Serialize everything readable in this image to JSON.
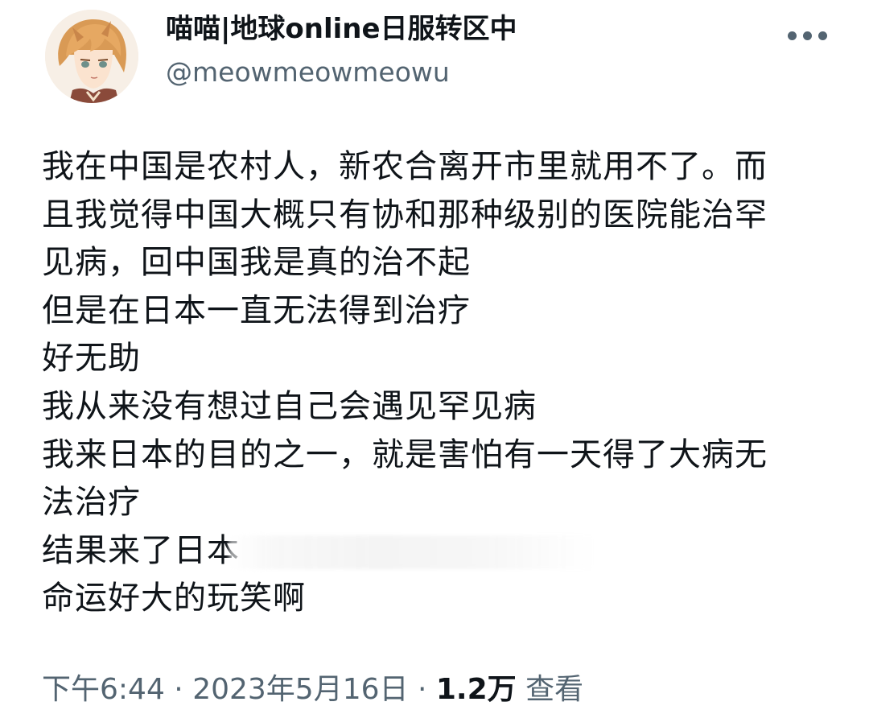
{
  "user": {
    "display_name": "喵喵|地球online日服转区中",
    "handle": "@meowmeowmeowu",
    "avatar_icon": "anime-avatar"
  },
  "more_icon": "more-horizontal-icon",
  "tweet": {
    "lines": [
      "我在中国是农村人，新农合离开市里就用不了。而",
      "且我觉得中国大概只有协和那种级别的医院能治罕",
      "见病，回中国我是真的治不起",
      "但是在日本一直无法得到治疗",
      "好无助",
      "我从来没有想过自己会遇见罕见病",
      "我来日本的目的之一，就是害怕有一天得了大病无",
      "法治疗",
      "结果来了日本",
      "命运好大的玩笑啊"
    ]
  },
  "meta": {
    "time": "下午6:44",
    "separator_1": " · ",
    "date": "2023年5月16日",
    "separator_2": " · ",
    "views_count": "1.2万",
    "views_label": " 查看"
  }
}
